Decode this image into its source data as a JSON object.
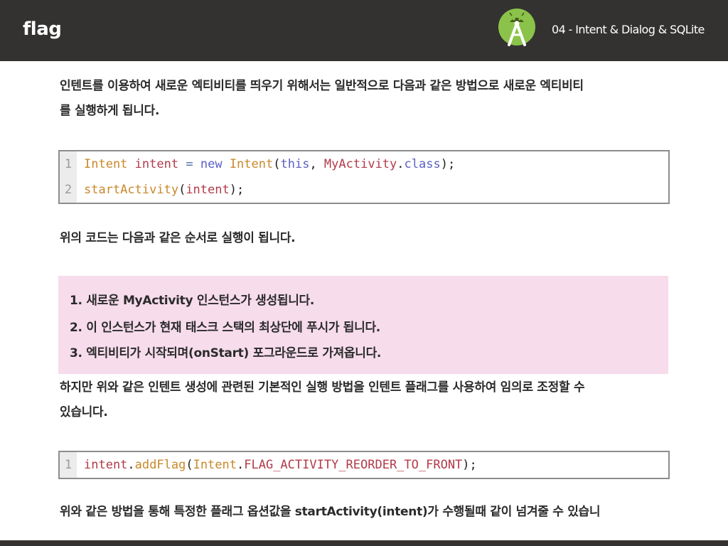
{
  "header": {
    "title": "flag",
    "subtitle": "04 - Intent & Dialog & SQLite",
    "logo_icon": "android-studio-icon"
  },
  "paragraphs": {
    "p1_line1": "인텐트를 이용하여 새로운 엑티비티를 띄우기 위해서는 일반적으로 다음과 같은 방법으로 새로운 엑티비티",
    "p1_line2": "를 실행하게 됩니다.",
    "p2": "위의 코드는 다음과 같은 순서로 실행이 됩니다.",
    "p3_line1": "하지만 위와 같은 인텐트 생성에 관련된 기본적인 실행 방법을 인텐트 플래그를 사용하여 임의로 조정할 수",
    "p3_line2": "있습니다.",
    "p4": "위와 같은 방법을 통해 특정한 플래그 옵션값을 startActivity(intent)가 수행될때 같이 넘겨줄 수 있습니"
  },
  "code1": {
    "lines": [
      {
        "num": "1",
        "tokens": [
          "Intent",
          " ",
          "intent",
          " ",
          "=",
          " ",
          "new",
          " ",
          "Intent",
          "(",
          "this",
          ", ",
          "MyActivity",
          ".",
          "class",
          ");"
        ]
      },
      {
        "num": "2",
        "tokens": [
          "startActivity",
          "(",
          "intent",
          ");"
        ]
      }
    ]
  },
  "note": {
    "items": [
      "1. 새로운 MyActivity 인스턴스가 생성됩니다.",
      "2. 이 인스턴스가 현재 태스크 스택의 최상단에 푸시가 됩니다.",
      "3. 엑티비티가 시작되며(onStart) 포그라운드로 가져옵니다."
    ]
  },
  "code2": {
    "lines": [
      {
        "num": "1",
        "tokens": [
          "intent",
          ".",
          "addFlag",
          "(",
          "Intent",
          ".",
          "FLAG_ACTIVITY_REORDER_TO_FRONT",
          ");"
        ]
      }
    ]
  },
  "colors": {
    "header_bg": "#333231",
    "note_bg": "#f7dcec",
    "code_border": "#8d8d8d"
  }
}
